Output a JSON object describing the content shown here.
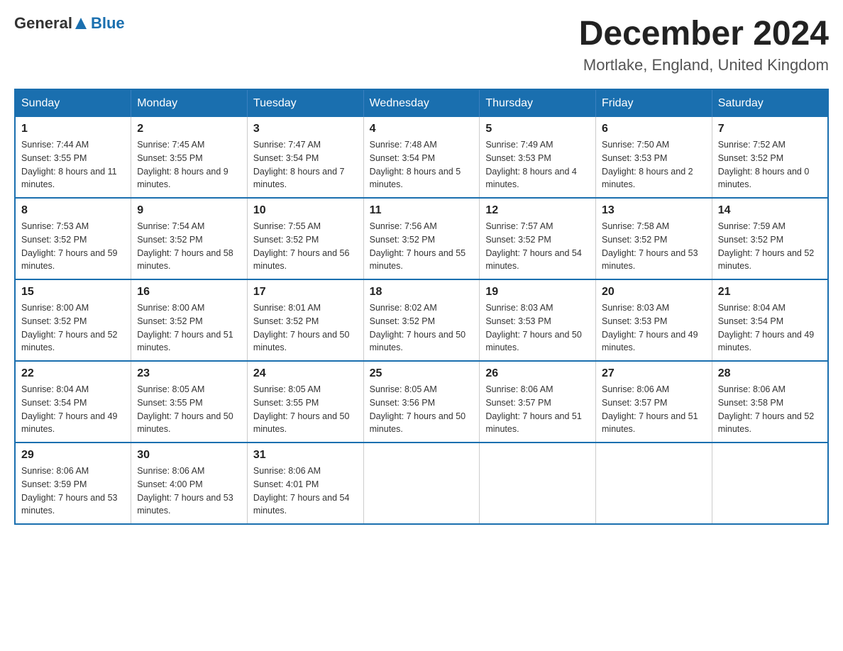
{
  "header": {
    "logo_general": "General",
    "logo_blue": "Blue",
    "month_title": "December 2024",
    "location": "Mortlake, England, United Kingdom"
  },
  "days_of_week": [
    "Sunday",
    "Monday",
    "Tuesday",
    "Wednesday",
    "Thursday",
    "Friday",
    "Saturday"
  ],
  "weeks": [
    [
      {
        "day": "1",
        "sunrise": "7:44 AM",
        "sunset": "3:55 PM",
        "daylight": "8 hours and 11 minutes."
      },
      {
        "day": "2",
        "sunrise": "7:45 AM",
        "sunset": "3:55 PM",
        "daylight": "8 hours and 9 minutes."
      },
      {
        "day": "3",
        "sunrise": "7:47 AM",
        "sunset": "3:54 PM",
        "daylight": "8 hours and 7 minutes."
      },
      {
        "day": "4",
        "sunrise": "7:48 AM",
        "sunset": "3:54 PM",
        "daylight": "8 hours and 5 minutes."
      },
      {
        "day": "5",
        "sunrise": "7:49 AM",
        "sunset": "3:53 PM",
        "daylight": "8 hours and 4 minutes."
      },
      {
        "day": "6",
        "sunrise": "7:50 AM",
        "sunset": "3:53 PM",
        "daylight": "8 hours and 2 minutes."
      },
      {
        "day": "7",
        "sunrise": "7:52 AM",
        "sunset": "3:52 PM",
        "daylight": "8 hours and 0 minutes."
      }
    ],
    [
      {
        "day": "8",
        "sunrise": "7:53 AM",
        "sunset": "3:52 PM",
        "daylight": "7 hours and 59 minutes."
      },
      {
        "day": "9",
        "sunrise": "7:54 AM",
        "sunset": "3:52 PM",
        "daylight": "7 hours and 58 minutes."
      },
      {
        "day": "10",
        "sunrise": "7:55 AM",
        "sunset": "3:52 PM",
        "daylight": "7 hours and 56 minutes."
      },
      {
        "day": "11",
        "sunrise": "7:56 AM",
        "sunset": "3:52 PM",
        "daylight": "7 hours and 55 minutes."
      },
      {
        "day": "12",
        "sunrise": "7:57 AM",
        "sunset": "3:52 PM",
        "daylight": "7 hours and 54 minutes."
      },
      {
        "day": "13",
        "sunrise": "7:58 AM",
        "sunset": "3:52 PM",
        "daylight": "7 hours and 53 minutes."
      },
      {
        "day": "14",
        "sunrise": "7:59 AM",
        "sunset": "3:52 PM",
        "daylight": "7 hours and 52 minutes."
      }
    ],
    [
      {
        "day": "15",
        "sunrise": "8:00 AM",
        "sunset": "3:52 PM",
        "daylight": "7 hours and 52 minutes."
      },
      {
        "day": "16",
        "sunrise": "8:00 AM",
        "sunset": "3:52 PM",
        "daylight": "7 hours and 51 minutes."
      },
      {
        "day": "17",
        "sunrise": "8:01 AM",
        "sunset": "3:52 PM",
        "daylight": "7 hours and 50 minutes."
      },
      {
        "day": "18",
        "sunrise": "8:02 AM",
        "sunset": "3:52 PM",
        "daylight": "7 hours and 50 minutes."
      },
      {
        "day": "19",
        "sunrise": "8:03 AM",
        "sunset": "3:53 PM",
        "daylight": "7 hours and 50 minutes."
      },
      {
        "day": "20",
        "sunrise": "8:03 AM",
        "sunset": "3:53 PM",
        "daylight": "7 hours and 49 minutes."
      },
      {
        "day": "21",
        "sunrise": "8:04 AM",
        "sunset": "3:54 PM",
        "daylight": "7 hours and 49 minutes."
      }
    ],
    [
      {
        "day": "22",
        "sunrise": "8:04 AM",
        "sunset": "3:54 PM",
        "daylight": "7 hours and 49 minutes."
      },
      {
        "day": "23",
        "sunrise": "8:05 AM",
        "sunset": "3:55 PM",
        "daylight": "7 hours and 50 minutes."
      },
      {
        "day": "24",
        "sunrise": "8:05 AM",
        "sunset": "3:55 PM",
        "daylight": "7 hours and 50 minutes."
      },
      {
        "day": "25",
        "sunrise": "8:05 AM",
        "sunset": "3:56 PM",
        "daylight": "7 hours and 50 minutes."
      },
      {
        "day": "26",
        "sunrise": "8:06 AM",
        "sunset": "3:57 PM",
        "daylight": "7 hours and 51 minutes."
      },
      {
        "day": "27",
        "sunrise": "8:06 AM",
        "sunset": "3:57 PM",
        "daylight": "7 hours and 51 minutes."
      },
      {
        "day": "28",
        "sunrise": "8:06 AM",
        "sunset": "3:58 PM",
        "daylight": "7 hours and 52 minutes."
      }
    ],
    [
      {
        "day": "29",
        "sunrise": "8:06 AM",
        "sunset": "3:59 PM",
        "daylight": "7 hours and 53 minutes."
      },
      {
        "day": "30",
        "sunrise": "8:06 AM",
        "sunset": "4:00 PM",
        "daylight": "7 hours and 53 minutes."
      },
      {
        "day": "31",
        "sunrise": "8:06 AM",
        "sunset": "4:01 PM",
        "daylight": "7 hours and 54 minutes."
      },
      null,
      null,
      null,
      null
    ]
  ]
}
